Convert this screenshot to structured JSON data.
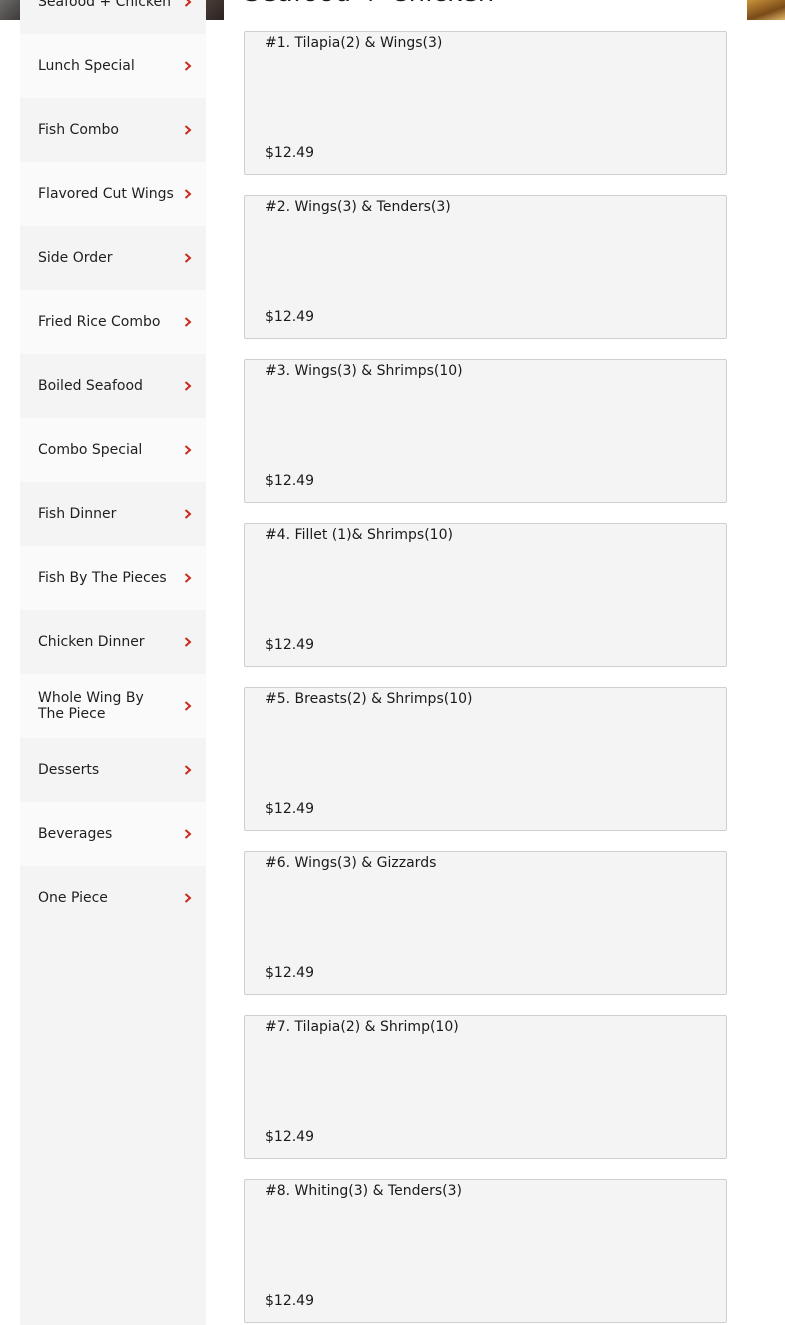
{
  "section": {
    "title": "Seafood + Chicken"
  },
  "sidebar": {
    "items": [
      {
        "label": "Seafood + Chicken"
      },
      {
        "label": "Lunch Special"
      },
      {
        "label": "Fish Combo"
      },
      {
        "label": "Flavored Cut Wings"
      },
      {
        "label": "Side Order"
      },
      {
        "label": "Fried Rice Combo"
      },
      {
        "label": "Boiled Seafood"
      },
      {
        "label": "Combo Special"
      },
      {
        "label": "Fish Dinner"
      },
      {
        "label": "Fish By The Pieces"
      },
      {
        "label": "Chicken Dinner"
      },
      {
        "label": "Whole Wing By The Piece"
      },
      {
        "label": "Desserts"
      },
      {
        "label": "Beverages"
      },
      {
        "label": "One Piece"
      }
    ],
    "chevron_icon": "chevron-right-icon",
    "chevron_color": "#cc2a1f"
  },
  "menu": {
    "items": [
      {
        "name": "#1. Tilapia(2) & Wings(3)",
        "price": "$12.49"
      },
      {
        "name": "#2. Wings(3) & Tenders(3)",
        "price": "$12.49"
      },
      {
        "name": "#3. Wings(3) & Shrimps(10)",
        "price": "$12.49"
      },
      {
        "name": "#4. Fillet (1)& Shrimps(10)",
        "price": "$12.49"
      },
      {
        "name": "#5. Breasts(2) & Shrimps(10)",
        "price": "$12.49"
      },
      {
        "name": "#6. Wings(3) & Gizzards",
        "price": "$12.49"
      },
      {
        "name": "#7. Tilapia(2) & Shrimp(10)",
        "price": "$12.49"
      },
      {
        "name": "#8. Whiting(3) & Tenders(3)",
        "price": "$12.49"
      }
    ]
  }
}
